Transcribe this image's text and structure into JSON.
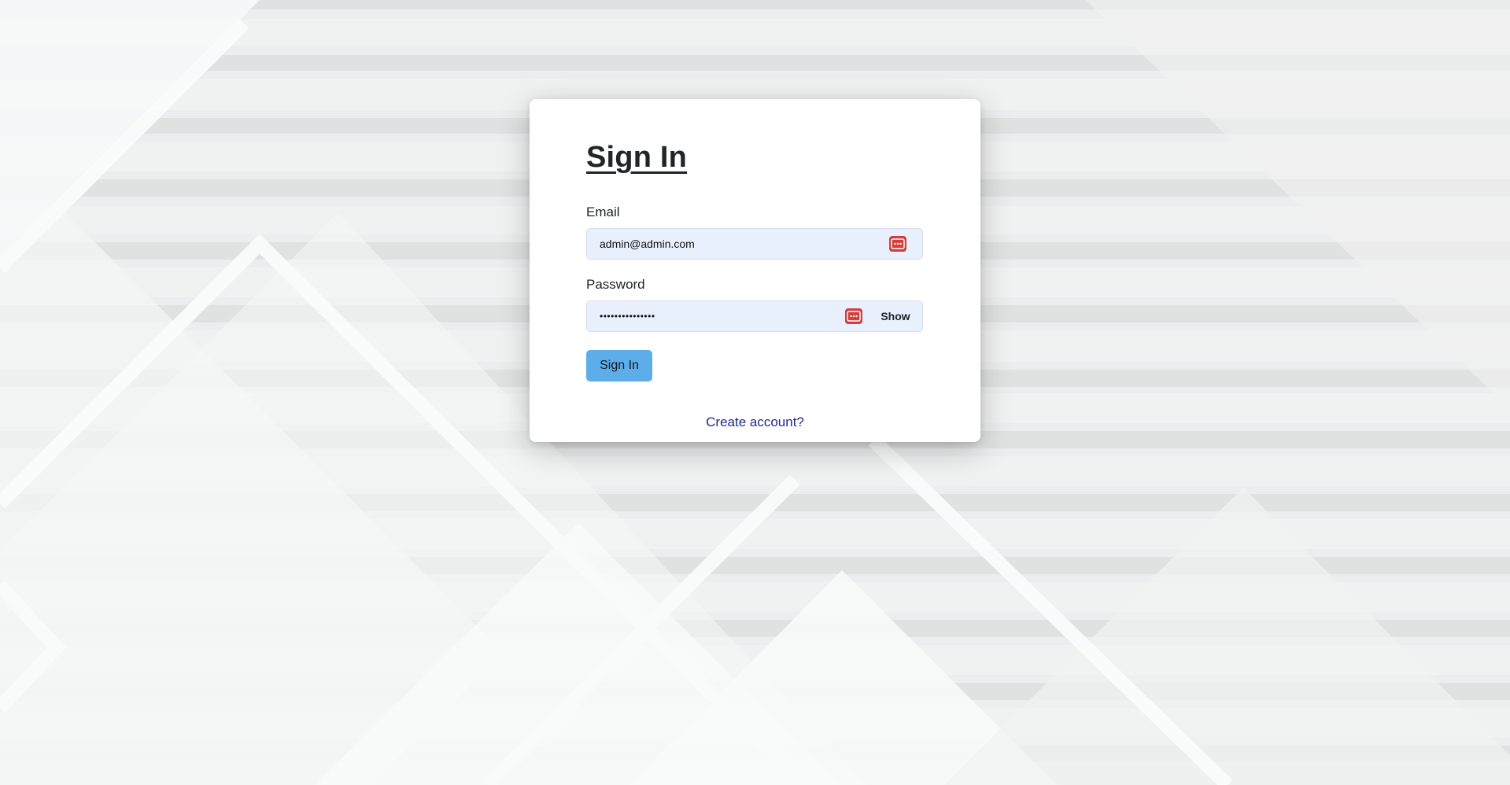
{
  "login": {
    "title": "Sign In",
    "email": {
      "label": "Email",
      "value": "admin@admin.com"
    },
    "password": {
      "label": "Password",
      "value": "•••••••••••••••",
      "show_label": "Show"
    },
    "submit_label": "Sign In",
    "create_account_label": "Create account?"
  },
  "icons": {
    "autofill": "password-manager-icon"
  },
  "colors": {
    "button_bg": "#5dade8",
    "input_bg": "#e8f0fe",
    "autofill_icon": "#d23f3f",
    "link": "#1b2a8a"
  }
}
